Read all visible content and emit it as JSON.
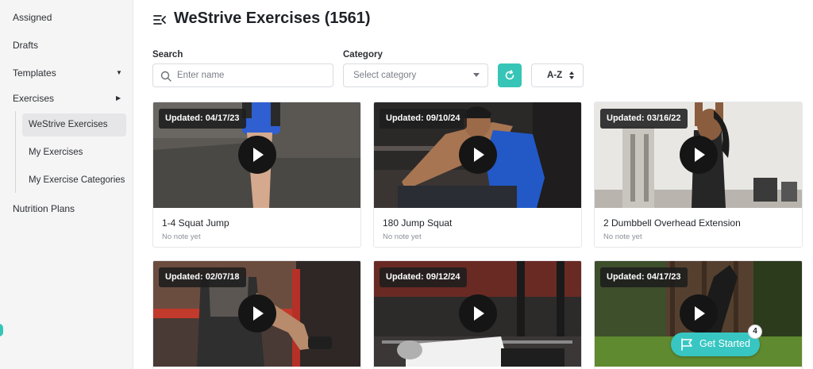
{
  "sidebar": {
    "items": [
      {
        "label": "Assigned"
      },
      {
        "label": "Drafts"
      },
      {
        "label": "Templates"
      },
      {
        "label": "Exercises"
      },
      {
        "label": "Nutrition Plans"
      }
    ],
    "exercises_sub": [
      {
        "label": "WeStrive Exercises",
        "active": true
      },
      {
        "label": "My Exercises"
      },
      {
        "label": "My Exercise Categories"
      }
    ]
  },
  "header": {
    "title": "WeStrive Exercises (1561)",
    "collapse_icon": "collapse-menu-icon"
  },
  "filters": {
    "search_label": "Search",
    "search_placeholder": "Enter name",
    "category_label": "Category",
    "category_placeholder": "Select category",
    "refresh_icon": "refresh-icon",
    "sort_label": "A-Z"
  },
  "cards": [
    {
      "updated": "Updated: 04/17/23",
      "title": "1-4 Squat Jump",
      "note": "No note yet"
    },
    {
      "updated": "Updated: 09/10/24",
      "title": "180 Jump Squat",
      "note": "No note yet"
    },
    {
      "updated": "Updated: 03/16/22",
      "title": "2 Dumbbell Overhead Extension",
      "note": "No note yet"
    },
    {
      "updated": "Updated: 02/07/18"
    },
    {
      "updated": "Updated: 09/12/24"
    },
    {
      "updated": "Updated: 04/17/23"
    }
  ],
  "get_started": {
    "label": "Get Started",
    "badge": "4"
  },
  "colors": {
    "accent": "#36c5b6",
    "get_started": "#38c6c2",
    "sidebar_bg": "#f5f5f6"
  }
}
